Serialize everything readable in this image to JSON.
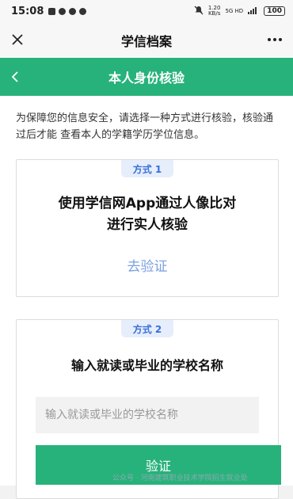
{
  "status_bar": {
    "time": "15:08",
    "speed_value": "1.20",
    "speed_unit": "KB/s",
    "network": "5G HD",
    "battery": "100"
  },
  "title_bar": {
    "title": "学信档案",
    "close_icon": "close-icon",
    "more_icon": "more-icon"
  },
  "nav_bar": {
    "title": "本人身份核验",
    "back_icon": "chevron-left-icon"
  },
  "intro_text": "为保障您的信息安全，请选择一种方式进行核验，核验通过后才能 查看本人的学籍学历学位信息。",
  "method1": {
    "badge": "方式 1",
    "line1": "使用学信网App通过人像比对",
    "line2": "进行实人核验",
    "action": "去验证"
  },
  "method2": {
    "badge": "方式 2",
    "title": "输入就读或毕业的学校名称",
    "input_placeholder": "输入就读或毕业的学校名称",
    "button": "验证"
  },
  "watermark": "公众号 · 河南建筑职业技术学院招生就业处",
  "colors": {
    "primary_green": "#28b27b",
    "link_blue": "#7a9fe0",
    "badge_bg": "#e6eefc"
  }
}
